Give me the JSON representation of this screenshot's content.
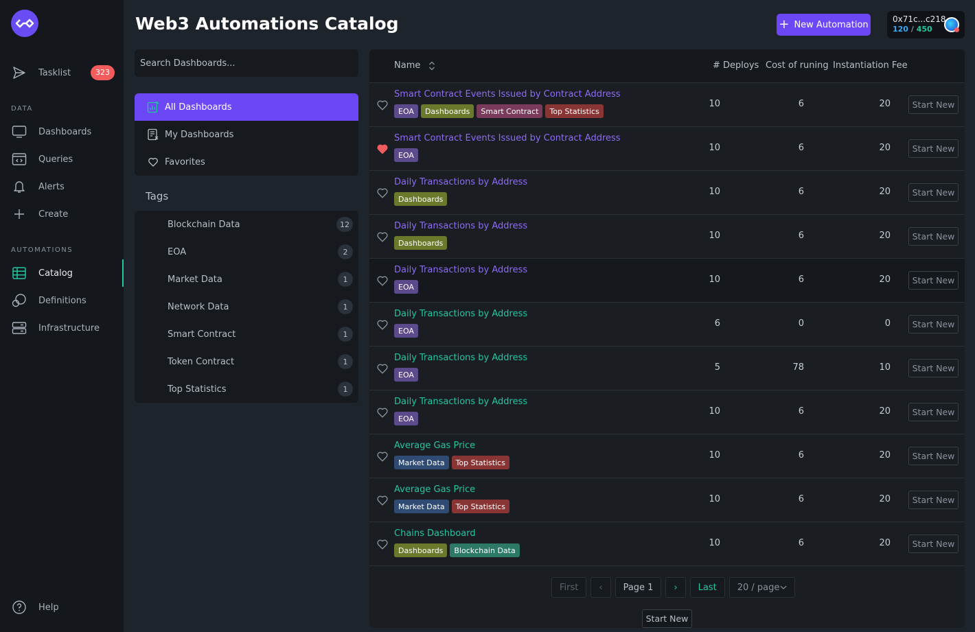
{
  "page": {
    "title": "Web3 Automations Catalog"
  },
  "header": {
    "new_automation_label": "New Automation",
    "wallet_address": "0x71c...c218",
    "wallet_used": "120",
    "wallet_sep": "/",
    "wallet_total": "450"
  },
  "sidebar": {
    "tasklist_label": "Tasklist",
    "tasklist_badge": "323",
    "data_section": "DATA",
    "data_items": [
      "Dashboards",
      "Queries",
      "Alerts",
      "Create"
    ],
    "automations_section": "AUTOMATIONS",
    "automation_items": [
      "Catalog",
      "Definitions",
      "Infrastructure"
    ],
    "help_label": "Help",
    "active_item": "Catalog"
  },
  "search": {
    "placeholder": "Search Dashboards..."
  },
  "dashboards_menu": {
    "all": "All Dashboards",
    "mine": "My Dashboards",
    "favorites": "Favorites"
  },
  "tags": {
    "title": "Tags",
    "items": [
      {
        "label": "Blockchain Data",
        "count": "12"
      },
      {
        "label": "EOA",
        "count": "2"
      },
      {
        "label": "Market Data",
        "count": "1"
      },
      {
        "label": "Network Data",
        "count": "1"
      },
      {
        "label": "Smart Contract",
        "count": "1"
      },
      {
        "label": "Token Contract",
        "count": "1"
      },
      {
        "label": "Top Statistics",
        "count": "1"
      }
    ]
  },
  "table": {
    "columns": {
      "name": "Name",
      "deploys": "# Deploys",
      "cost": "Cost of runing",
      "fee": "Instantiation Fee"
    },
    "start_label": "Start New",
    "rows": [
      {
        "name": "Smart Contract Events Issued by Contract Address",
        "color": "purple",
        "favorite": false,
        "tags": [
          "EOA",
          "Dashboards",
          "Smart Contract",
          "Top Statistics"
        ],
        "deploys": "10",
        "cost": "6",
        "fee": "20"
      },
      {
        "name": "Smart Contract Events Issued by Contract Address",
        "color": "purple",
        "favorite": true,
        "tags": [
          "EOA"
        ],
        "deploys": "10",
        "cost": "6",
        "fee": "20"
      },
      {
        "name": "Daily Transactions by Address",
        "color": "purple",
        "favorite": false,
        "tags": [
          "Dashboards"
        ],
        "deploys": "10",
        "cost": "6",
        "fee": "20"
      },
      {
        "name": "Daily Transactions by Address",
        "color": "purple",
        "favorite": false,
        "tags": [
          "Dashboards"
        ],
        "deploys": "10",
        "cost": "6",
        "fee": "20"
      },
      {
        "name": "Daily Transactions by Address",
        "color": "purple",
        "favorite": false,
        "tags": [
          "EOA"
        ],
        "deploys": "10",
        "cost": "6",
        "fee": "20",
        "highlight": true
      },
      {
        "name": "Daily Transactions by Address",
        "color": "green",
        "favorite": false,
        "tags": [
          "EOA"
        ],
        "deploys": "6",
        "cost": "0",
        "fee": "0"
      },
      {
        "name": "Daily Transactions by Address",
        "color": "green",
        "favorite": false,
        "tags": [
          "EOA"
        ],
        "deploys": "5",
        "cost": "78",
        "fee": "10"
      },
      {
        "name": "Daily Transactions by Address",
        "color": "green",
        "favorite": false,
        "tags": [
          "EOA"
        ],
        "deploys": "10",
        "cost": "6",
        "fee": "20"
      },
      {
        "name": "Average Gas Price",
        "color": "green",
        "favorite": false,
        "tags": [
          "Market Data",
          "Top Statistics"
        ],
        "deploys": "10",
        "cost": "6",
        "fee": "20"
      },
      {
        "name": "Average Gas Price",
        "color": "green",
        "favorite": false,
        "tags": [
          "Market Data",
          "Top Statistics"
        ],
        "deploys": "10",
        "cost": "6",
        "fee": "20"
      },
      {
        "name": "Chains Dashboard",
        "color": "green",
        "favorite": false,
        "tags": [
          "Dashboards",
          "Blockchain Data"
        ],
        "deploys": "10",
        "cost": "6",
        "fee": "20"
      }
    ]
  },
  "pagination": {
    "first": "First",
    "prev": "‹",
    "page": "Page 1",
    "next": "›",
    "last": "Last",
    "per_page": "20 / page"
  },
  "bottom_start_label": "Start New",
  "colors": {
    "accent": "#6c47f5",
    "green": "#22c7a0",
    "badge": "#f25c5c"
  }
}
